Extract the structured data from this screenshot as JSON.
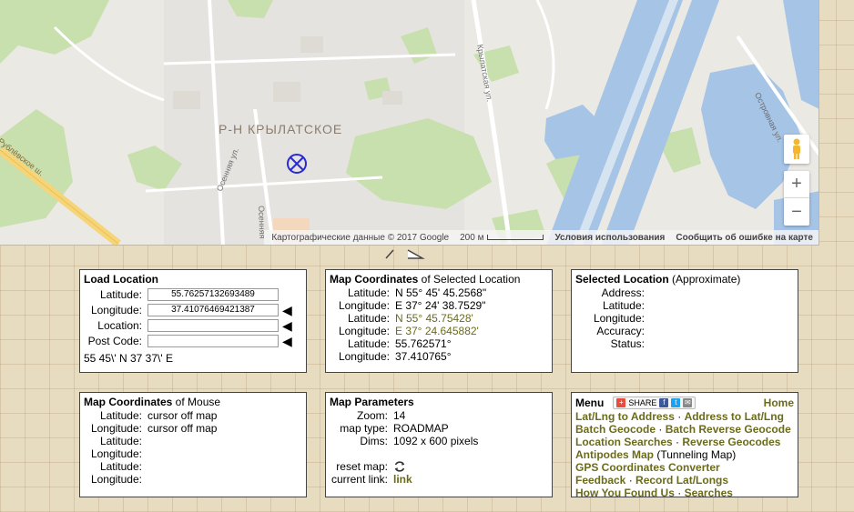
{
  "map": {
    "district_label": "Р-Н КРЫЛАТСКОЕ",
    "streets": {
      "krylatskaya": "Крылатская ул.",
      "osennyaya": "Осенняя ул.",
      "osennyaya_short": "Осенняя",
      "ostrovnaya": "Островная ул.",
      "rublevskoe": "Рублёвское ш."
    },
    "attribution": "Картографические данные © 2017 Google",
    "scale_label": "200 м",
    "terms_link": "Условия использования",
    "report_link": "Сообщить об ошибке на карте",
    "zoom_in": "+",
    "zoom_out": "−"
  },
  "load_location": {
    "title": "Load Location",
    "latitude_label": "Latitude:",
    "latitude_value": "55.76257132693489",
    "longitude_label": "Longitude:",
    "longitude_value": "37.41076469421387",
    "location_label": "Location:",
    "location_value": "",
    "postcode_label": "Post Code:",
    "postcode_value": "",
    "dms_text": "55 45\\' N 37 37\\' E"
  },
  "map_coordinates_selected": {
    "title_bold": "Map Coordinates",
    "title_rest": " of Selected Location",
    "rows": [
      {
        "label": "Latitude:",
        "value": "N 55° 45' 45.2568\""
      },
      {
        "label": "Longitude:",
        "value": "E 37° 24' 38.7529\""
      },
      {
        "label": "Latitude:",
        "value": "N 55° 45.75428'"
      },
      {
        "label": "Longitude:",
        "value": "E 37° 24.645882'"
      },
      {
        "label": "Latitude:",
        "value": "55.762571°"
      },
      {
        "label": "Longitude:",
        "value": "37.410765°"
      }
    ]
  },
  "selected_location": {
    "title_bold": "Selected Location",
    "title_rest": " (Approximate)",
    "rows": [
      {
        "label": "Address:",
        "value": ""
      },
      {
        "label": "Latitude:",
        "value": ""
      },
      {
        "label": "Longitude:",
        "value": ""
      },
      {
        "label": "Accuracy:",
        "value": ""
      },
      {
        "label": "Status:",
        "value": ""
      }
    ]
  },
  "map_coordinates_mouse": {
    "title_bold": "Map Coordinates",
    "title_rest": " of Mouse",
    "rows": [
      {
        "label": "Latitude:",
        "value": "cursor off map"
      },
      {
        "label": "Longitude:",
        "value": "cursor off map"
      },
      {
        "label": "Latitude:",
        "value": ""
      },
      {
        "label": "Longitude:",
        "value": ""
      },
      {
        "label": "Latitude:",
        "value": ""
      },
      {
        "label": "Longitude:",
        "value": ""
      }
    ]
  },
  "map_parameters": {
    "title": "Map Parameters",
    "zoom_label": "Zoom:",
    "zoom_value": "14",
    "maptype_label": "map type:",
    "maptype_value": "ROADMAP",
    "dims_label": "Dims:",
    "dims_value": "1092 x 600 pixels",
    "reset_label": "reset map:",
    "current_link_label": "current link:",
    "current_link_value": "link"
  },
  "menu": {
    "title": "Menu",
    "share_label": "SHARE",
    "home_label": "Home",
    "line1_a": "Lat/Lng to Address",
    "line1_b": "Address to Lat/Lng",
    "line2_a": "Batch Geocode",
    "line2_b": "Batch Reverse Geocode",
    "line3_a": "Location Searches",
    "line3_b": "Reverse Geocodes",
    "line4_a": "Antipodes Map",
    "line4_b": " (Tunneling Map)",
    "line5_a": "GPS Coordinates Converter",
    "line6_a": "Feedback",
    "line6_b": "Record Lat/Longs",
    "line7_a": "How You Found Us",
    "line7_b": "Searches",
    "separator": " · "
  },
  "colors": {
    "link_olive": "#6b6b1c",
    "water": "#a5c4e6",
    "park": "#c8dfae",
    "marker": "#2a2ad4"
  }
}
